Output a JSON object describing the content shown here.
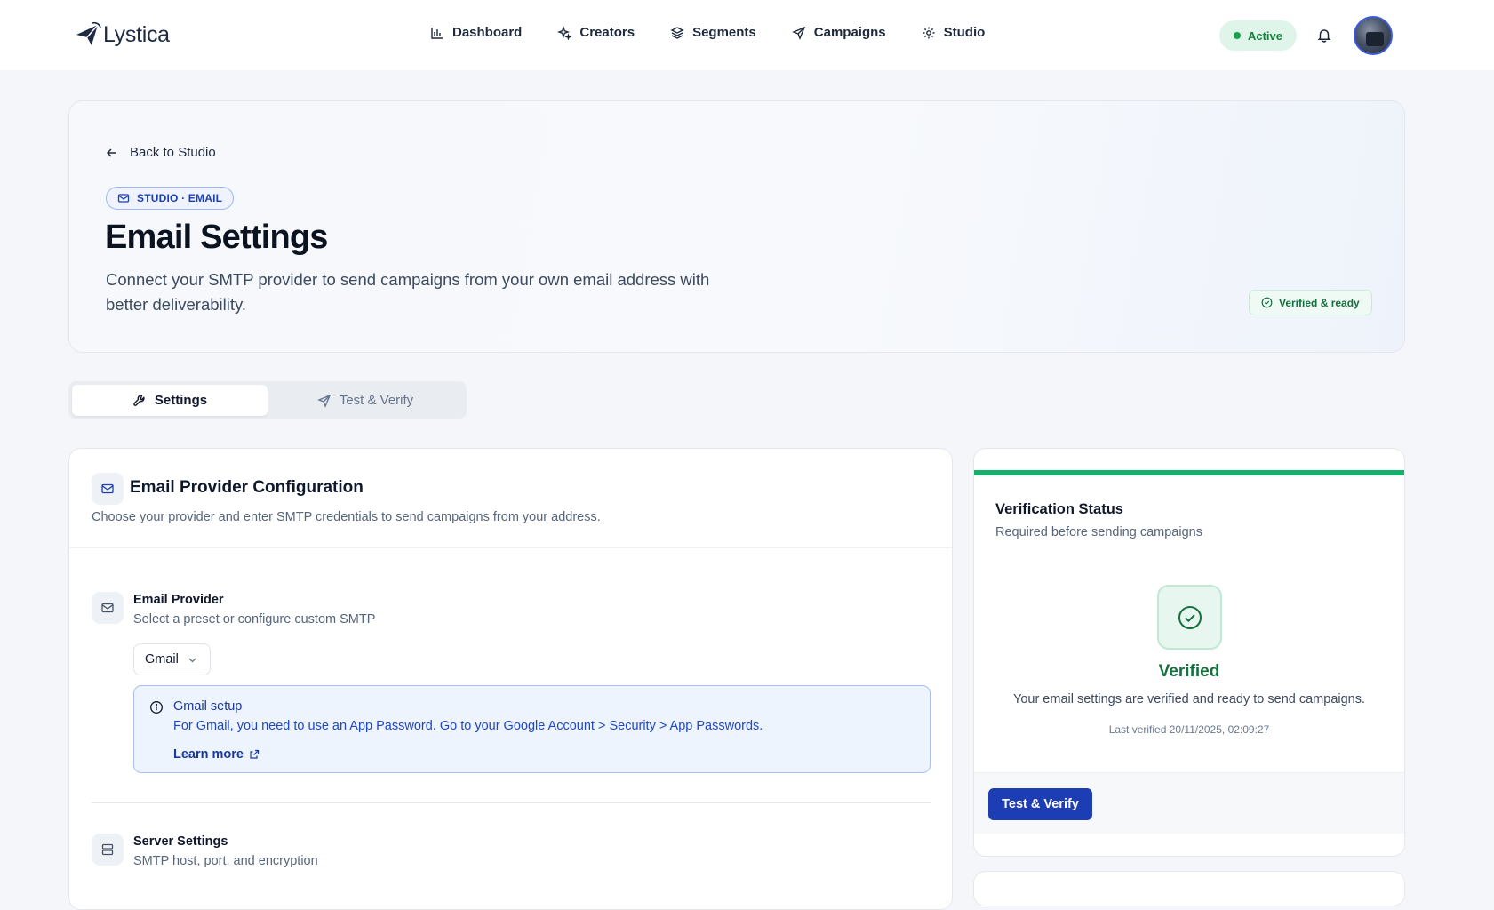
{
  "brand": {
    "name": "Lystica"
  },
  "nav": {
    "items": [
      {
        "label": "Dashboard",
        "icon": "bar-chart-icon"
      },
      {
        "label": "Creators",
        "icon": "sparkles-icon"
      },
      {
        "label": "Segments",
        "icon": "layers-icon"
      },
      {
        "label": "Campaigns",
        "icon": "send-icon"
      },
      {
        "label": "Studio",
        "icon": "gear-icon"
      }
    ],
    "status": "Active"
  },
  "hero": {
    "back": "Back to Studio",
    "crumb": "STUDIO · EMAIL",
    "title": "Email Settings",
    "subtitle": "Connect your SMTP provider to send campaigns from your own email address with better deliverability.",
    "status_chip": "Verified & ready"
  },
  "tabs": [
    {
      "label": "Settings",
      "active": true
    },
    {
      "label": "Test & Verify",
      "active": false
    }
  ],
  "config": {
    "title": "Email Provider Configuration",
    "description": "Choose your provider and enter SMTP credentials to send campaigns from your address.",
    "provider": {
      "title": "Email Provider",
      "description": "Select a preset or configure custom SMTP",
      "selected": "Gmail"
    },
    "notice": {
      "title": "Gmail setup",
      "text": "For Gmail, you need to use an App Password. Go to your Google Account > Security > App Passwords.",
      "link": "Learn more"
    },
    "server": {
      "title": "Server Settings",
      "description": "SMTP host, port, and encryption"
    }
  },
  "verification": {
    "title": "Verification Status",
    "subtitle": "Required before sending campaigns",
    "state": "Verified",
    "message": "Your email settings are verified and ready to send campaigns.",
    "last_verified": "Last verified 20/11/2025, 02:09:27",
    "button": "Test & Verify"
  },
  "colors": {
    "accent": "#1d3db5",
    "success": "#16b06a",
    "info_bg": "#eef4fd"
  }
}
